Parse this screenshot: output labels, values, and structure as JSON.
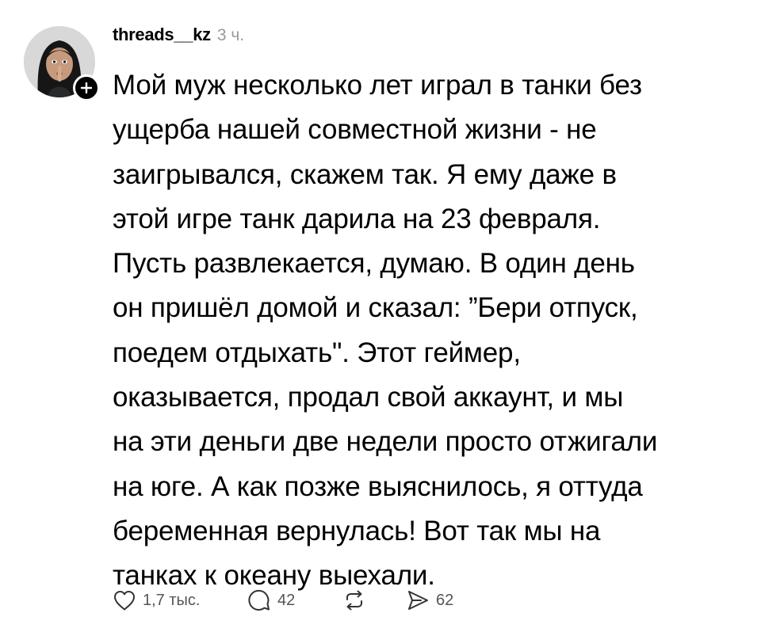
{
  "post": {
    "author": {
      "username": "threads__kz",
      "time": "3 ч."
    },
    "body_lines": [
      "Мой муж несколько лет играл в танки без",
      "ущерба нашей совместной жизни - не",
      "заигрывался, скажем так. Я ему даже в",
      "этой игре танк дарила на 23 февраля.",
      "Пусть развлекается, думаю. В один день",
      "он пришёл домой и сказал: ”Бери отпуск,",
      "поедем отдыхать\". Этот геймер,",
      "оказывается, продал свой аккаунт, и мы",
      "на эти деньги две недели просто отжигали",
      "на юге. А как позже выяснилось, я оттуда",
      "беременная вернулась! Вот так мы на",
      "танках к океану выехали."
    ],
    "stats": {
      "likes": "1,7 тыс.",
      "replies": "42",
      "shares": "62"
    }
  },
  "icons": {
    "avatar": "profile-photo",
    "follow": "plus-icon",
    "like": "heart-icon",
    "reply": "speech-bubble-icon",
    "repost": "repost-icon",
    "share": "send-icon"
  },
  "colors": {
    "text": "#000000",
    "muted": "#9a9a9a",
    "counts": "#555555",
    "background": "#ffffff"
  }
}
